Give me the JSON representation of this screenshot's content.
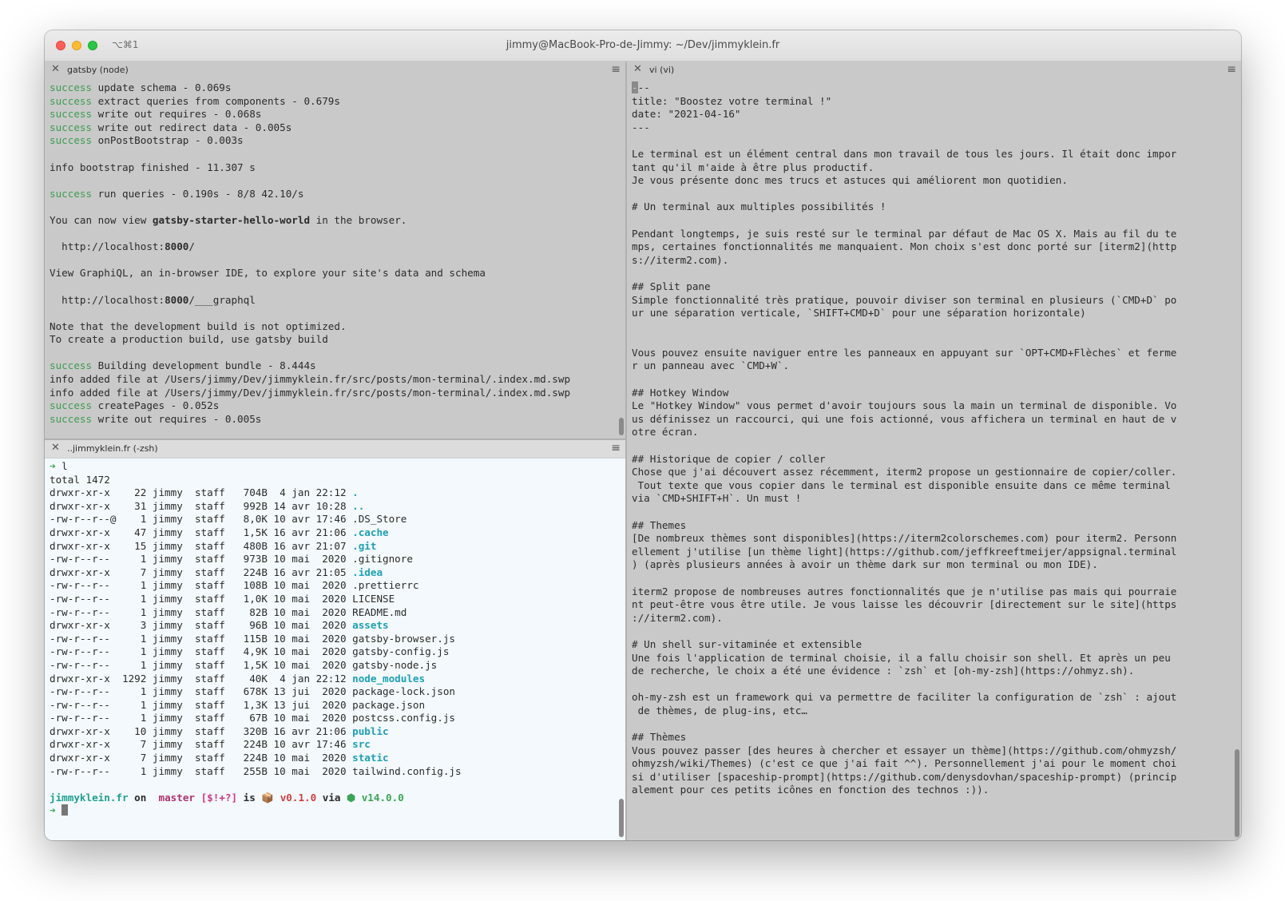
{
  "window": {
    "shortcut": "⌥⌘1",
    "title": "jimmy@MacBook-Pro-de-Jimmy: ~/Dev/jimmyklein.fr"
  },
  "panes": {
    "gatsby": {
      "title": "gatsby (node)",
      "lines": [
        {
          "kind": "success",
          "label": "success",
          "text": " update schema - 0.069s"
        },
        {
          "kind": "success",
          "label": "success",
          "text": " extract queries from components - 0.679s"
        },
        {
          "kind": "success",
          "label": "success",
          "text": " write out requires - 0.068s"
        },
        {
          "kind": "success",
          "label": "success",
          "text": " write out redirect data - 0.005s"
        },
        {
          "kind": "success",
          "label": "success",
          "text": " onPostBootstrap - 0.003s"
        },
        {
          "kind": "plain",
          "text": ""
        },
        {
          "kind": "plain",
          "text": "info bootstrap finished - 11.307 s"
        },
        {
          "kind": "plain",
          "text": ""
        },
        {
          "kind": "success",
          "label": "success",
          "text": " run queries - 0.190s - 8/8 42.10/s"
        },
        {
          "kind": "plain",
          "text": ""
        },
        {
          "kind": "rich",
          "before": "You can now view ",
          "bold": "gatsby-starter-hello-world",
          "after": " in the browser."
        },
        {
          "kind": "plain",
          "text": ""
        },
        {
          "kind": "rich",
          "before": "  http://localhost:",
          "bold": "8000",
          "after": "/"
        },
        {
          "kind": "plain",
          "text": ""
        },
        {
          "kind": "plain",
          "text": "View GraphiQL, an in-browser IDE, to explore your site's data and schema"
        },
        {
          "kind": "plain",
          "text": ""
        },
        {
          "kind": "rich",
          "before": "  http://localhost:",
          "bold": "8000",
          "after": "/___graphql"
        },
        {
          "kind": "plain",
          "text": ""
        },
        {
          "kind": "plain",
          "text": "Note that the development build is not optimized."
        },
        {
          "kind": "plain",
          "text": "To create a production build, use gatsby build"
        },
        {
          "kind": "plain",
          "text": ""
        },
        {
          "kind": "success",
          "label": "success",
          "text": " Building development bundle - 8.444s"
        },
        {
          "kind": "plain",
          "text": "info added file at /Users/jimmy/Dev/jimmyklein.fr/src/posts/mon-terminal/.index.md.swp"
        },
        {
          "kind": "plain",
          "text": "info added file at /Users/jimmy/Dev/jimmyklein.fr/src/posts/mon-terminal/.index.md.swp"
        },
        {
          "kind": "success",
          "label": "success",
          "text": " createPages - 0.052s"
        },
        {
          "kind": "success",
          "label": "success",
          "text": " write out requires - 0.005s"
        }
      ]
    },
    "zsh": {
      "title": "..jimmyklein.fr (-zsh)",
      "command_prompt": "➜ ",
      "command": "l",
      "total": "total 1472",
      "listing": [
        {
          "prefix": "drwxr-xr-x    22 jimmy  staff   704B  4 jan 22:12 ",
          "name": ".",
          "dir": true
        },
        {
          "prefix": "drwxr-xr-x    31 jimmy  staff   992B 14 avr 10:28 ",
          "name": "..",
          "dir": true
        },
        {
          "prefix": "-rw-r--r--@    1 jimmy  staff   8,0K 10 avr 17:46 ",
          "name": ".DS_Store",
          "dir": false
        },
        {
          "prefix": "drwxr-xr-x    47 jimmy  staff   1,5K 16 avr 21:06 ",
          "name": ".cache",
          "dir": true
        },
        {
          "prefix": "drwxr-xr-x    15 jimmy  staff   480B 16 avr 21:07 ",
          "name": ".git",
          "dir": true
        },
        {
          "prefix": "-rw-r--r--     1 jimmy  staff   973B 10 mai  2020 ",
          "name": ".gitignore",
          "dir": false
        },
        {
          "prefix": "drwxr-xr-x     7 jimmy  staff   224B 16 avr 21:05 ",
          "name": ".idea",
          "dir": true
        },
        {
          "prefix": "-rw-r--r--     1 jimmy  staff   108B 10 mai  2020 ",
          "name": ".prettierrc",
          "dir": false
        },
        {
          "prefix": "-rw-r--r--     1 jimmy  staff   1,0K 10 mai  2020 ",
          "name": "LICENSE",
          "dir": false
        },
        {
          "prefix": "-rw-r--r--     1 jimmy  staff    82B 10 mai  2020 ",
          "name": "README.md",
          "dir": false
        },
        {
          "prefix": "drwxr-xr-x     3 jimmy  staff    96B 10 mai  2020 ",
          "name": "assets",
          "dir": true
        },
        {
          "prefix": "-rw-r--r--     1 jimmy  staff   115B 10 mai  2020 ",
          "name": "gatsby-browser.js",
          "dir": false
        },
        {
          "prefix": "-rw-r--r--     1 jimmy  staff   4,9K 10 mai  2020 ",
          "name": "gatsby-config.js",
          "dir": false
        },
        {
          "prefix": "-rw-r--r--     1 jimmy  staff   1,5K 10 mai  2020 ",
          "name": "gatsby-node.js",
          "dir": false
        },
        {
          "prefix": "drwxr-xr-x  1292 jimmy  staff    40K  4 jan 22:12 ",
          "name": "node_modules",
          "dir": true
        },
        {
          "prefix": "-rw-r--r--     1 jimmy  staff   678K 13 jui  2020 ",
          "name": "package-lock.json",
          "dir": false
        },
        {
          "prefix": "-rw-r--r--     1 jimmy  staff   1,3K 13 jui  2020 ",
          "name": "package.json",
          "dir": false
        },
        {
          "prefix": "-rw-r--r--     1 jimmy  staff    67B 10 mai  2020 ",
          "name": "postcss.config.js",
          "dir": false
        },
        {
          "prefix": "drwxr-xr-x    10 jimmy  staff   320B 16 avr 21:06 ",
          "name": "public",
          "dir": true
        },
        {
          "prefix": "drwxr-xr-x     7 jimmy  staff   224B 10 avr 17:46 ",
          "name": "src",
          "dir": true
        },
        {
          "prefix": "drwxr-xr-x     7 jimmy  staff   224B 10 mai  2020 ",
          "name": "static",
          "dir": true
        },
        {
          "prefix": "-rw-r--r--     1 jimmy  staff   255B 10 mai  2020 ",
          "name": "tailwind.config.js",
          "dir": false
        }
      ],
      "prompt": {
        "dir": "jimmyklein.fr",
        "on": " on ",
        "branch_icon": "",
        "branch": " master",
        "status": " [$!+?]",
        "is": " is ",
        "package_icon": "📦",
        "version": " v0.1.0",
        "via": " via ",
        "node_icon": "⬢",
        "node_version": " v14.0.0",
        "arrow": "➜ "
      }
    },
    "vi": {
      "title": "vi (vi)",
      "first_char": "-",
      "first_rest": "--",
      "lines": [
        "title: \"Boostez votre terminal !\"",
        "date: \"2021-04-16\"",
        "---",
        "",
        "Le terminal est un élément central dans mon travail de tous les jours. Il était donc impor",
        "tant qu'il m'aide à être plus productif.",
        "Je vous présente donc mes trucs et astuces qui améliorent mon quotidien.",
        "",
        "# Un terminal aux multiples possibilités !",
        "",
        "Pendant longtemps, je suis resté sur le terminal par défaut de Mac OS X. Mais au fil du te",
        "mps, certaines fonctionnalités me manquaient. Mon choix s'est donc porté sur [iterm2](http",
        "s://iterm2.com).",
        "",
        "## Split pane",
        "Simple fonctionnalité très pratique, pouvoir diviser son terminal en plusieurs (`CMD+D` po",
        "ur une séparation verticale, `SHIFT+CMD+D` pour une séparation horizontale)",
        "",
        "",
        "Vous pouvez ensuite naviguer entre les panneaux en appuyant sur `OPT+CMD+Flèches` et ferme",
        "r un panneau avec `CMD+W`.",
        "",
        "## Hotkey Window",
        "Le \"Hotkey Window\" vous permet d'avoir toujours sous la main un terminal de disponible. Vo",
        "us définissez un raccourci, qui une fois actionné, vous affichera un terminal en haut de v",
        "otre écran.",
        "",
        "## Historique de copier / coller",
        "Chose que j'ai découvert assez récemment, iterm2 propose un gestionnaire de copier/coller.",
        " Tout texte que vous copier dans le terminal est disponible ensuite dans ce même terminal",
        "via `CMD+SHIFT+H`. Un must !",
        "",
        "## Themes",
        "[De nombreux thèmes sont disponibles](https://iterm2colorschemes.com) pour iterm2. Personn",
        "ellement j'utilise [un thème light](https://github.com/jeffkreeftmeijer/appsignal.terminal",
        ") (après plusieurs années à avoir un thème dark sur mon terminal ou mon IDE).",
        "",
        "iterm2 propose de nombreuses autres fonctionnalités que je n'utilise pas mais qui pourraie",
        "nt peut-être vous être utile. Je vous laisse les découvrir [directement sur le site](https",
        "://iterm2.com).",
        "",
        "# Un shell sur-vitaminée et extensible",
        "Une fois l'application de terminal choisie, il a fallu choisir son shell. Et après un peu",
        "de recherche, le choix a été une évidence : `zsh` et [oh-my-zsh](https://ohmyz.sh).",
        "",
        "oh-my-zsh est un framework qui va permettre de faciliter la configuration de `zsh` : ajout",
        " de thèmes, de plug-ins, etc…",
        "",
        "## Thèmes",
        "Vous pouvez passer [des heures à chercher et essayer un thème](https://github.com/ohmyzsh/",
        "ohmyzsh/wiki/Themes) (c'est ce que j'ai fait ^^). Personnellement j'ai pour le moment choi",
        "si d'utiliser [spaceship-prompt](https://github.com/denysdovhan/spaceship-prompt) (princip",
        "alement pour ces petits icônes en fonction des technos :))."
      ]
    }
  }
}
